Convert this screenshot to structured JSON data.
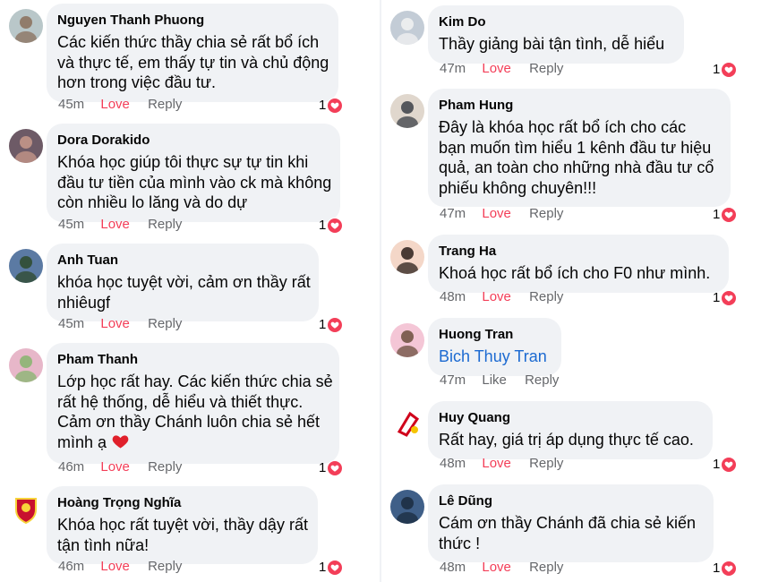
{
  "colors": {
    "love": "#f33e58",
    "link": "#1c6ad1",
    "bubble": "#f0f2f5",
    "meta": "#65676b"
  },
  "left": [
    {
      "author": "Nguyen Thanh Phuong",
      "avatar_icon": "avatar-woman-beach",
      "lines": [
        "Các kiến thức thầy chia sẻ rất bổ ích",
        "và thực tế, em thấy tự tin và chủ động",
        "hơn trong việc đầu tư."
      ],
      "time": "45m",
      "action": "Love",
      "reply": "Reply",
      "reactions": "1"
    },
    {
      "author": "Dora Dorakido",
      "avatar_icon": "avatar-woman",
      "lines": [
        "Khóa học giúp tôi thực sự tự tin khi",
        "đầu tư tiền của mình vào ck mà không",
        "còn nhiều lo lăng và do dự"
      ],
      "time": "45m",
      "action": "Love",
      "reply": "Reply",
      "reactions": "1"
    },
    {
      "author": "Anh Tuan",
      "avatar_icon": "avatar-landscape",
      "lines": [
        "khóa học tuyệt vời, cảm ơn thầy rất",
        "nhiêugf"
      ],
      "time": "45m",
      "action": "Love",
      "reply": "Reply",
      "reactions": "1"
    },
    {
      "author": "Pham Thanh",
      "avatar_icon": "avatar-lotus",
      "lines": [
        "Lớp học rất hay. Các kiến thức chia sẻ",
        "rất hệ thống, dễ hiểu và thiết thực.",
        "Cảm ơn thầy Chánh luôn chia sẻ hết",
        "mình ạ"
      ],
      "heart_emoji": "heart-emoji-icon",
      "time": "46m",
      "action": "Love",
      "reply": "Reply",
      "reactions": "1"
    },
    {
      "author": "Hoàng Trọng Nghĩa",
      "avatar_icon": "avatar-club-crest",
      "lines": [
        "Khóa học rất tuyệt vời, thầy dậy rất",
        "tận tình nữa!"
      ],
      "time": "46m",
      "action": "Love",
      "reply": "Reply",
      "reactions": "1"
    }
  ],
  "right": [
    {
      "author": "Kim Do",
      "avatar_icon": "avatar-plush-toy",
      "lines": [
        "Thầy giảng bài tận tình, dễ hiểu"
      ],
      "time": "47m",
      "action": "Love",
      "reply": "Reply",
      "reactions": "1"
    },
    {
      "author": "Pham Hung",
      "avatar_icon": "avatar-man",
      "lines": [
        "Đây là khóa học rất bổ ích cho các",
        "bạn muốn tìm hiểu 1 kênh đầu tư hiệu",
        "quả, an toàn cho những nhà đầu tư cổ",
        "phiếu không chuyên!!!"
      ],
      "time": "47m",
      "action": "Love",
      "reply": "Reply",
      "reactions": "1"
    },
    {
      "author": "Trang Ha",
      "avatar_icon": "avatar-woman-portrait",
      "lines": [
        "Khoá học rất bổ ích cho F0 như mình."
      ],
      "time": "48m",
      "action": "Love",
      "reply": "Reply",
      "reactions": "1"
    },
    {
      "author": "Huong Tran",
      "avatar_icon": "avatar-woman-dress",
      "lines": [
        "Bich Thuy Tran"
      ],
      "is_link": true,
      "time": "47m",
      "action": "Like",
      "reply": "Reply",
      "reactions": ""
    },
    {
      "author": "Huy Quang",
      "avatar_icon": "avatar-logo-red",
      "lines": [
        "Rất hay, giá trị áp dụng thực tế cao."
      ],
      "time": "48m",
      "action": "Love",
      "reply": "Reply",
      "reactions": "1"
    },
    {
      "author": "Lê Dũng",
      "avatar_icon": "avatar-photo-group",
      "lines": [
        "Cám ơn thầy Chánh đã chia sẻ kiến",
        "thức !"
      ],
      "time": "48m",
      "action": "Love",
      "reply": "Reply",
      "reactions": "1"
    }
  ]
}
